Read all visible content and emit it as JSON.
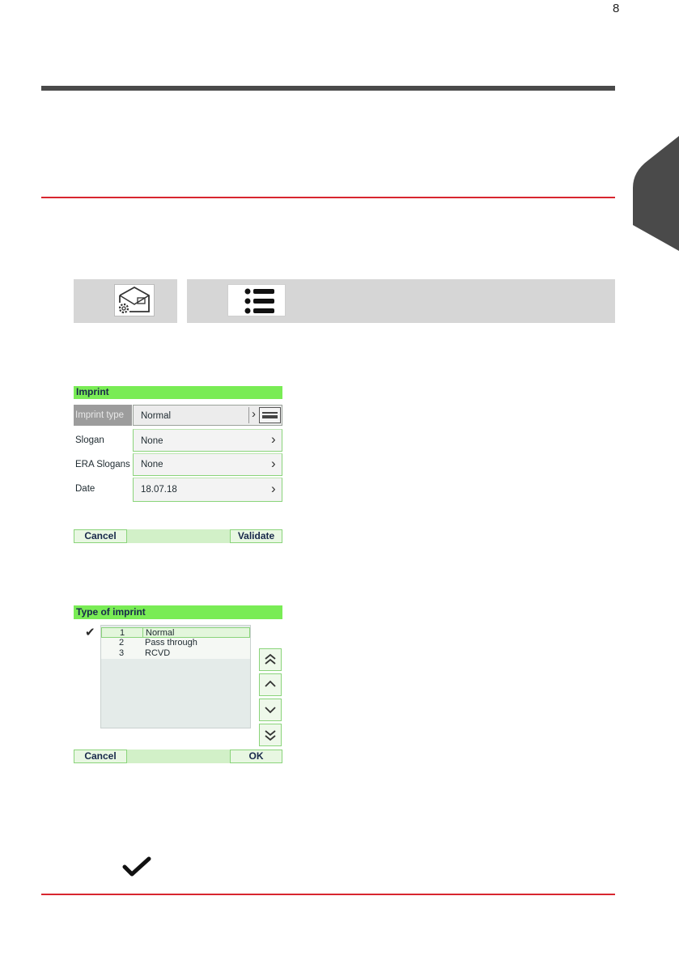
{
  "page": {
    "number": "8"
  },
  "path_bar": {
    "home_icon": "mail-settings-icon",
    "menu_icon": "list-menu-icon"
  },
  "imprint_screen": {
    "title": "Imprint",
    "rows": [
      {
        "label": "Imprint type",
        "value": "Normal"
      },
      {
        "label": "Slogan",
        "value": "None"
      },
      {
        "label": "ERA Slogans",
        "value": "None"
      },
      {
        "label": "Date",
        "value": "18.07.18"
      }
    ],
    "cancel_label": "Cancel",
    "validate_label": "Validate"
  },
  "type_screen": {
    "title": "Type of imprint",
    "items": [
      {
        "num": "1",
        "label": "Normal"
      },
      {
        "num": "2",
        "label": "Pass through"
      },
      {
        "num": "3",
        "label": "RCVD"
      }
    ],
    "cancel_label": "Cancel",
    "ok_label": "OK"
  },
  "colors": {
    "accent_red": "#d8262f",
    "screen_green": "#79ec55"
  }
}
